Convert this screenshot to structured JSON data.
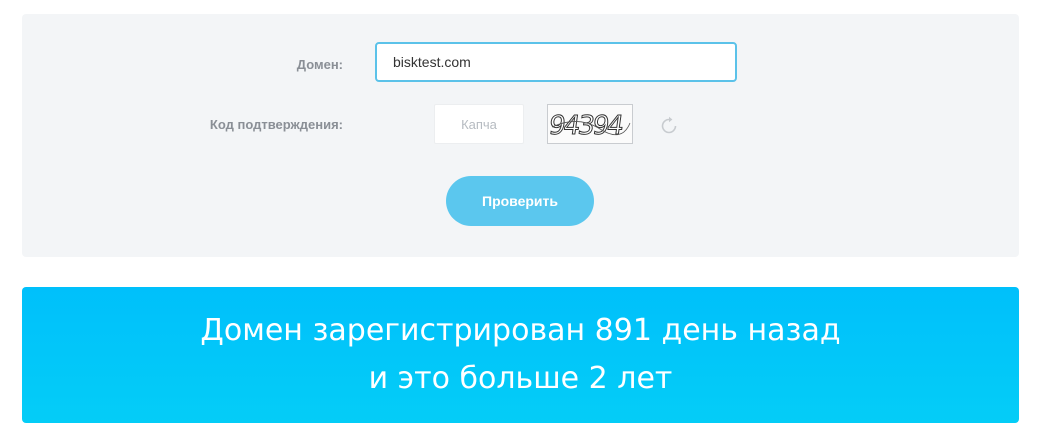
{
  "form": {
    "domain_label": "Домен:",
    "domain_value": "bisktest.com",
    "code_label": "Код подтверждения:",
    "captcha_placeholder": "Капча",
    "captcha_code": "94394",
    "check_button": "Проверить",
    "refresh_icon": "refresh-icon"
  },
  "result": {
    "line1": "Домен зарегистрирован 891 день назад",
    "line2": "и это больше 2 лет"
  },
  "colors": {
    "panel_bg": "#f3f5f7",
    "accent": "#5bc7ee",
    "banner": "#00c0fb"
  }
}
